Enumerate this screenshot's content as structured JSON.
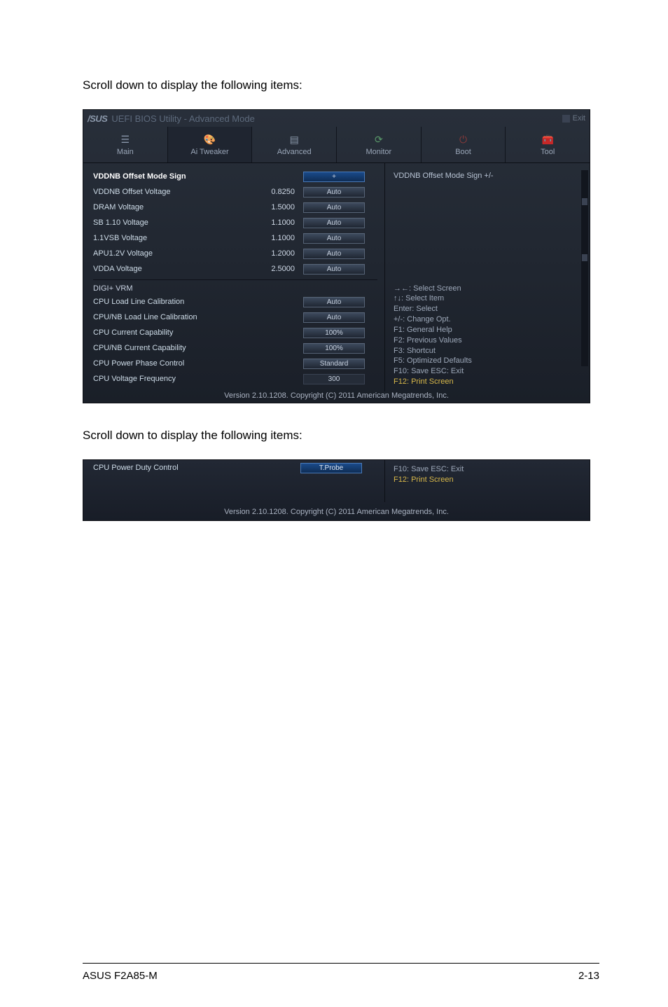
{
  "instruction_text": "Scroll down to display the following items:",
  "bios1": {
    "brand": "/SUS",
    "title": "UEFI BIOS Utility - Advanced Mode",
    "exit_label": "Exit",
    "tabs": {
      "main_label": "Main",
      "tweaker_label": "Ai Tweaker",
      "advanced_label": "Advanced",
      "monitor_label": "Monitor",
      "boot_label": "Boot",
      "tool_label": "Tool"
    },
    "left_rows": [
      {
        "label": "VDDNB Offset Mode Sign",
        "value": "",
        "btn": "+",
        "highlight": true,
        "active": true
      },
      {
        "label": "VDDNB Offset Voltage",
        "value": "0.8250",
        "btn": "Auto"
      },
      {
        "label": "DRAM Voltage",
        "value": "1.5000",
        "btn": "Auto"
      },
      {
        "label": "SB 1.10 Voltage",
        "value": "1.1000",
        "btn": "Auto"
      },
      {
        "label": "1.1VSB Voltage",
        "value": "1.1000",
        "btn": "Auto"
      },
      {
        "label": "APU1.2V Voltage",
        "value": "1.2000",
        "btn": "Auto"
      },
      {
        "label": "VDDA Voltage",
        "value": "2.5000",
        "btn": "Auto"
      }
    ],
    "digi_header": "DIGI+ VRM",
    "digi_rows": [
      {
        "label": "CPU Load Line Calibration",
        "btn": "Auto",
        "type": "auto"
      },
      {
        "label": "CPU/NB Load Line Calibration",
        "btn": "Auto",
        "type": "auto"
      },
      {
        "label": "CPU Current Capability",
        "btn": "100%",
        "type": "auto"
      },
      {
        "label": "CPU/NB Current Capability",
        "btn": "100%",
        "type": "auto"
      },
      {
        "label": "CPU Power Phase Control",
        "btn": "Standard",
        "type": "auto"
      },
      {
        "label": "CPU Voltage Frequency",
        "btn": "300",
        "type": "num"
      }
    ],
    "right_info": "VDDNB Offset Mode Sign +/-",
    "help": {
      "l1": "→←: Select Screen",
      "l2": "↑↓: Select Item",
      "l3": "Enter: Select",
      "l4": "+/-: Change Opt.",
      "l5": "F1: General Help",
      "l6": "F2: Previous Values",
      "l7": "F3: Shortcut",
      "l8": "F5: Optimized Defaults",
      "l9": "F10: Save  ESC: Exit",
      "l10": "F12: Print Screen"
    },
    "footer": "Version 2.10.1208. Copyright (C) 2011 American Megatrends, Inc."
  },
  "bios2": {
    "row_label": "CPU Power Duty Control",
    "row_btn": "T.Probe",
    "help_l1": "F10: Save  ESC: Exit",
    "help_l2": "F12: Print Screen",
    "footer": "Version 2.10.1208. Copyright (C) 2011 American Megatrends, Inc."
  },
  "page_footer": {
    "left": "ASUS F2A85-M",
    "right": "2-13"
  }
}
